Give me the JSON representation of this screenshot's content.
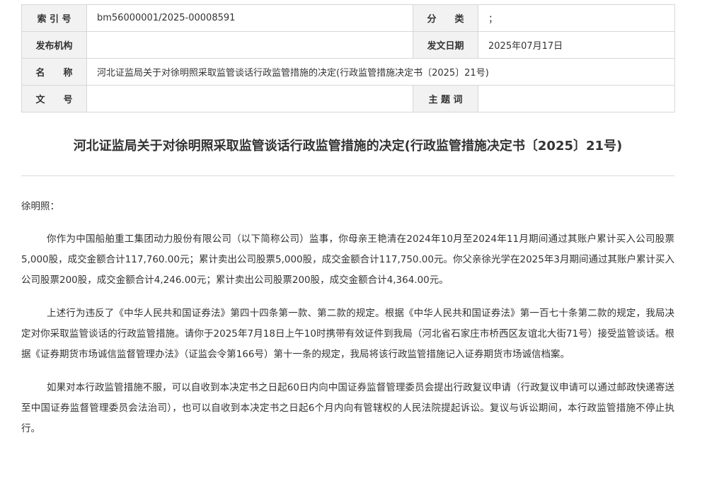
{
  "meta": {
    "index_label": "索 引 号",
    "index_value": "bm56000001/2025-00008591",
    "category_label": "分　　类",
    "category_value": "；",
    "issuer_label": "发布机构",
    "issuer_value": "",
    "date_label": "发文日期",
    "date_value": "2025年07月17日",
    "name_label": "名　　称",
    "name_value": "河北证监局关于对徐明照采取监管谈话行政监管措施的决定(行政监管措施决定书〔2025〕21号)",
    "docno_label": "文　　号",
    "docno_value": "",
    "keyword_label": "主 题 词",
    "keyword_value": ""
  },
  "document": {
    "title": "河北证监局关于对徐明照采取监管谈话行政监管措施的决定(行政监管措施决定书〔2025〕21号)",
    "salutation": "徐明照：",
    "paragraphs": [
      "你作为中国船舶重工集团动力股份有限公司（以下简称公司）监事，你母亲王艳清在2024年10月至2024年11月期间通过其账户累计买入公司股票5,000股，成交金额合计117,760.00元；累计卖出公司股票5,000股，成交金额合计117,750.00元。你父亲徐光学在2025年3月期间通过其账户累计买入公司股票200股，成交金额合计4,246.00元；累计卖出公司股票200股，成交金额合计4,364.00元。",
      "上述行为违反了《中华人民共和国证券法》第四十四条第一款、第二款的规定。根据《中华人民共和国证券法》第一百七十条第二款的规定，我局决定对你采取监管谈话的行政监管措施。请你于2025年7月18日上午10时携带有效证件到我局（河北省石家庄市桥西区友谊北大街71号）接受监管谈话。根据《证券期货市场诚信监督管理办法》（证监会令第166号）第十一条的规定，我局将该行政监管措施记入证券期货市场诚信档案。",
      "如果对本行政监管措施不服，可以自收到本决定书之日起60日内向中国证券监督管理委员会提出行政复议申请（行政复议申请可以通过邮政快递寄送至中国证券监督管理委员会法治司），也可以自收到本决定书之日起6个月内向有管辖权的人民法院提起诉讼。复议与诉讼期间，本行政监管措施不停止执行。"
    ]
  }
}
